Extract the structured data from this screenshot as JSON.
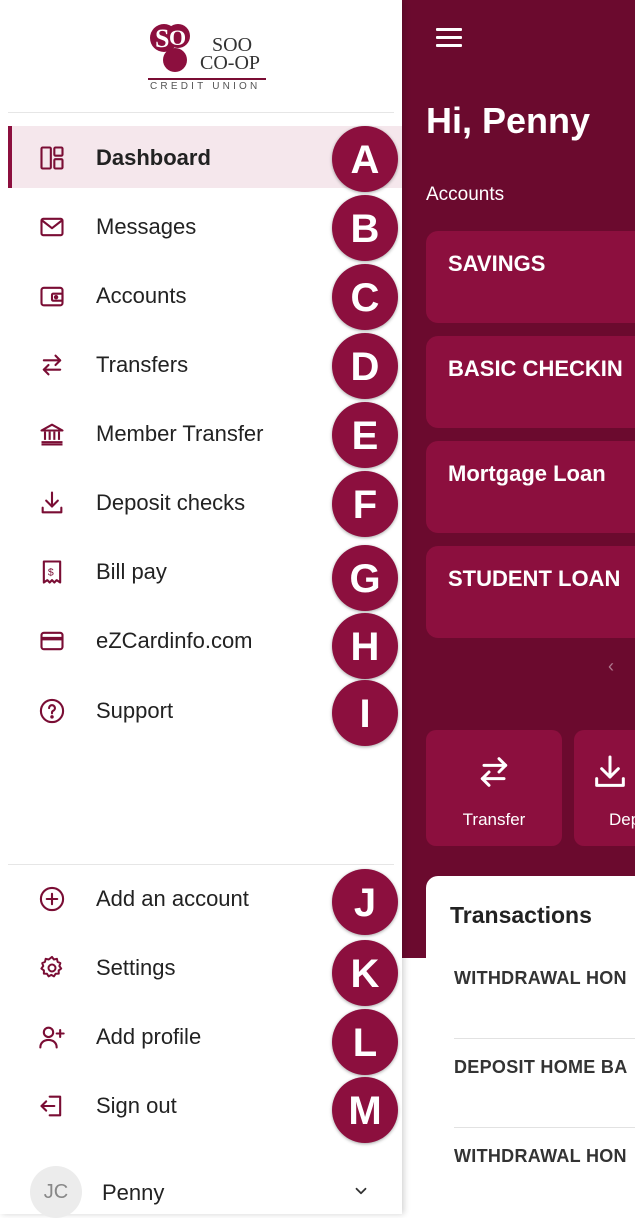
{
  "brand": {
    "logo_line1": "SOO",
    "logo_line2": "CO-OP",
    "logo_line3": "CREDIT UNION",
    "accent": "#8c0f3e",
    "dark_bg": "#6b0a2e"
  },
  "sidebar": {
    "items": [
      {
        "label": "Dashboard",
        "icon": "dashboard-icon",
        "marker": "A",
        "active": true
      },
      {
        "label": "Messages",
        "icon": "mail-icon",
        "marker": "B"
      },
      {
        "label": "Accounts",
        "icon": "wallet-icon",
        "marker": "C"
      },
      {
        "label": "Transfers",
        "icon": "transfer-arrows-icon",
        "marker": "D"
      },
      {
        "label": "Member Transfer",
        "icon": "bank-icon",
        "marker": "E"
      },
      {
        "label": "Deposit checks",
        "icon": "download-icon",
        "marker": "F"
      },
      {
        "label": "Bill pay",
        "icon": "bill-icon",
        "marker": "G"
      },
      {
        "label": "eZCardinfo.com",
        "icon": "credit-card-icon",
        "marker": "H"
      },
      {
        "label": "Support",
        "icon": "help-circle-icon",
        "marker": "I"
      }
    ],
    "bottom_items": [
      {
        "label": "Add an account",
        "icon": "plus-circle-icon",
        "marker": "J"
      },
      {
        "label": "Settings",
        "icon": "gear-icon",
        "marker": "K"
      },
      {
        "label": "Add profile",
        "icon": "add-user-icon",
        "marker": "L"
      },
      {
        "label": "Sign out",
        "icon": "sign-out-icon",
        "marker": "M"
      }
    ],
    "profile": {
      "initials": "JC",
      "name": "Penny"
    }
  },
  "main": {
    "greeting": "Hi, Penny",
    "accounts_label": "Accounts",
    "accounts": [
      "SAVINGS",
      "BASIC CHECKIN",
      "Mortgage Loan",
      "STUDENT LOAN"
    ],
    "carousel_prev": "‹",
    "actions": [
      {
        "label": "Transfer",
        "icon": "transfer-arrows-icon"
      },
      {
        "label": "Dep",
        "icon": "download-icon"
      }
    ],
    "transactions_title": "Transactions",
    "transactions": [
      "WITHDRAWAL HON",
      "DEPOSIT HOME BA",
      "WITHDRAWAL HON"
    ]
  }
}
